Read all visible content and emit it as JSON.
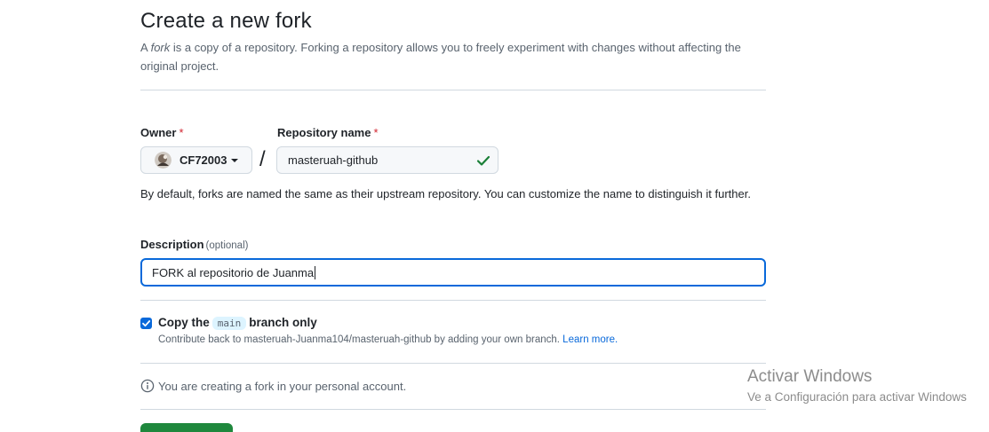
{
  "page": {
    "title": "Create a new fork",
    "intro_prefix": "A ",
    "intro_em": "fork",
    "intro_suffix": " is a copy of a repository. Forking a repository allows you to freely experiment with changes without affecting the original project."
  },
  "owner": {
    "label": "Owner",
    "required_mark": "*",
    "value": "CF72003"
  },
  "separator": "/",
  "repository_name": {
    "label": "Repository name",
    "required_mark": "*",
    "value": "masteruah-github",
    "valid": true
  },
  "name_help": "By default, forks are named the same as their upstream repository. You can customize the name to distinguish it further.",
  "description": {
    "label": "Description",
    "optional": "(optional)",
    "value": "FORK al repositorio de Juanma"
  },
  "copy_branch": {
    "checked": true,
    "label_prefix": "Copy the",
    "branch": "main",
    "label_suffix": "branch only",
    "help": "Contribute back to masteruah-Juanma104/masteruah-github by adding your own branch.",
    "link": "Learn more."
  },
  "notice": "You are creating a fork in your personal account.",
  "watermark": {
    "line1": "Activar Windows",
    "line2": "Ve a Configuración para activar Windows"
  },
  "colors": {
    "accent": "#0969da",
    "success": "#1a7f37",
    "primary_button": "#1f883d",
    "required": "#d1242f"
  }
}
